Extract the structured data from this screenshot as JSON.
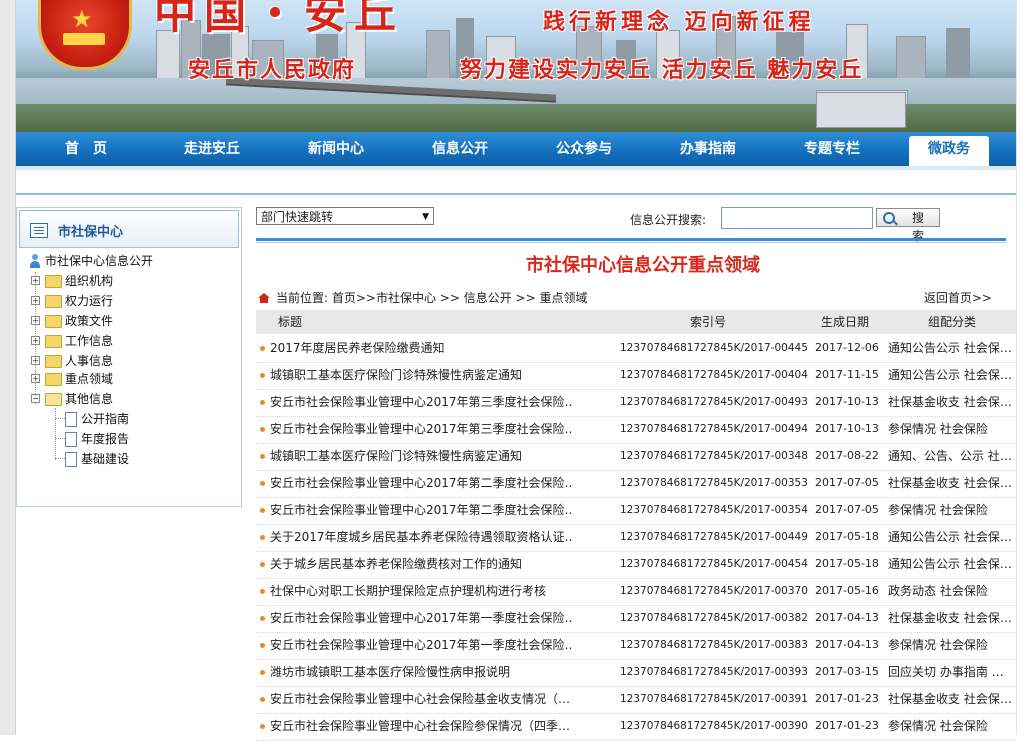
{
  "banner": {
    "title": "中国・安丘",
    "government": "安丘市人民政府",
    "slogan_top": "践行新理念 迈向新征程",
    "slogan_bottom": "努力建设实力安丘 活力安丘 魅力安丘"
  },
  "nav": {
    "items": [
      "首　页",
      "走进安丘",
      "新闻中心",
      "信息公开",
      "公众参与",
      "办事指南",
      "专题专栏",
      "微政务"
    ],
    "active": "微政务"
  },
  "sidebar": {
    "header": "市社保中心",
    "root": "市社保中心信息公开",
    "items": [
      "组织机构",
      "权力运行",
      "政策文件",
      "工作信息",
      "人事信息",
      "重点领域",
      "其他信息"
    ],
    "sub_items": [
      "公开指南",
      "年度报告",
      "基础建设"
    ]
  },
  "toolbar": {
    "dept_select": "部门快速跳转",
    "search_label": "信息公开搜索:",
    "search_value": "",
    "search_button": "搜 索"
  },
  "main": {
    "title": "市社保中心信息公开重点领域",
    "breadcrumb": "当前位置: 首页>>市社保中心 >> 信息公开 >> 重点领域",
    "back_link": "返回首页>>",
    "columns": [
      "标题",
      "索引号",
      "生成日期",
      "组配分类"
    ],
    "rows": [
      {
        "title": "2017年度居民养老保险缴费通知",
        "index": "12370784681727845K/2017-00445",
        "date": "2017-12-06",
        "category": "通知公告公示  社会保…"
      },
      {
        "title": "城镇职工基本医疗保险门诊特殊慢性病鉴定通知",
        "index": "12370784681727845K/2017-00404",
        "date": "2017-11-15",
        "category": "通知公告公示  社会保…"
      },
      {
        "title": "安丘市社会保险事业管理中心2017年第三季度社会保险…",
        "index": "12370784681727845K/2017-00493",
        "date": "2017-10-13",
        "category": "社保基金收支  社会保…"
      },
      {
        "title": "安丘市社会保险事业管理中心2017年第三季度社会保险…",
        "index": "12370784681727845K/2017-00494",
        "date": "2017-10-13",
        "category": "参保情况  社会保险"
      },
      {
        "title": "城镇职工基本医疗保险门诊特殊慢性病鉴定通知",
        "index": "12370784681727845K/2017-00348",
        "date": "2017-08-22",
        "category": "通知、公告、公示  社…"
      },
      {
        "title": "安丘市社会保险事业管理中心2017年第二季度社会保险…",
        "index": "12370784681727845K/2017-00353",
        "date": "2017-07-05",
        "category": "社保基金收支  社会保…"
      },
      {
        "title": "安丘市社会保险事业管理中心2017年第二季度社会保险…",
        "index": "12370784681727845K/2017-00354",
        "date": "2017-07-05",
        "category": "参保情况  社会保险"
      },
      {
        "title": "关于2017年度城乡居民基本养老保险待遇领取资格认证…",
        "index": "12370784681727845K/2017-00449",
        "date": "2017-05-18",
        "category": "通知公告公示  社会保…"
      },
      {
        "title": "关于城乡居民基本养老保险缴费核对工作的通知",
        "index": "12370784681727845K/2017-00454",
        "date": "2017-05-18",
        "category": "通知公告公示  社会保…"
      },
      {
        "title": "社保中心对职工长期护理保险定点护理机构进行考核",
        "index": "12370784681727845K/2017-00370",
        "date": "2017-05-16",
        "category": "政务动态  社会保险"
      },
      {
        "title": "安丘市社会保险事业管理中心2017年第一季度社会保险…",
        "index": "12370784681727845K/2017-00382",
        "date": "2017-04-13",
        "category": "社保基金收支  社会保…"
      },
      {
        "title": "安丘市社会保险事业管理中心2017年第一季度社会保险…",
        "index": "12370784681727845K/2017-00383",
        "date": "2017-04-13",
        "category": "参保情况  社会保险"
      },
      {
        "title": "潍坊市城镇职工基本医疗保险慢性病申报说明",
        "index": "12370784681727845K/2017-00393",
        "date": "2017-03-15",
        "category": "回应关切  办事指南  …"
      },
      {
        "title": "安丘市社会保险事业管理中心社会保险基金收支情况（…",
        "index": "12370784681727845K/2017-00391",
        "date": "2017-01-23",
        "category": "社保基金收支  社会保…"
      },
      {
        "title": "安丘市社会保险事业管理中心社会保险参保情况（四季…",
        "index": "12370784681727845K/2017-00390",
        "date": "2017-01-23",
        "category": "参保情况  社会保险"
      }
    ]
  }
}
